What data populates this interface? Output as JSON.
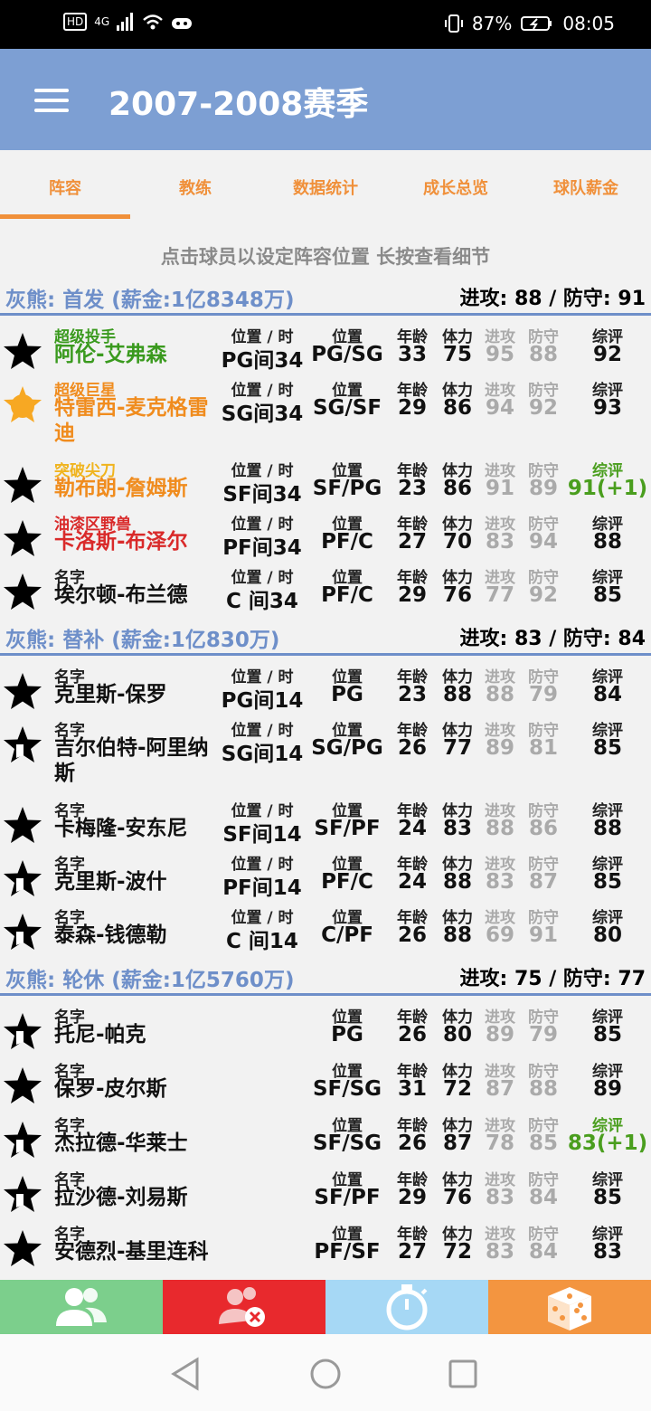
{
  "status": {
    "signal": "4G",
    "hd": "HD",
    "battery": "87%",
    "time": "08:05"
  },
  "app": {
    "title": "2007-2008赛季"
  },
  "tabs": [
    "阵容",
    "教练",
    "数据统计",
    "成长总览",
    "球队薪金"
  ],
  "hint": "点击球员以设定阵容位置 长按查看细节",
  "labels": {
    "pos_time": "位置 / 时",
    "pos": "位置",
    "age": "年龄",
    "stamina": "体力",
    "attack": "进攻",
    "defense": "防守",
    "overall": "综评"
  },
  "sections": [
    {
      "title": "灰熊: 首发 (薪金:1亿8348万)",
      "stats": "进攻: 88  /  防守: 91",
      "players": [
        {
          "tag": "超级投手",
          "tag_color": "#3a9a1e",
          "name": "阿伦-艾弗森",
          "name_color": "#3a9a1e",
          "pos_time": "PG间34",
          "pos": "PG/SG",
          "age": "33",
          "stamina": "75",
          "attack": "95",
          "defense": "88",
          "overall": "92",
          "star": "black"
        },
        {
          "tag": "超级巨星",
          "tag_color": "#f08c1e",
          "name": "特雷西-麦克格雷迪",
          "name_color": "#f08c1e",
          "pos_time": "SG间34",
          "pos": "SG/SF",
          "age": "29",
          "stamina": "86",
          "attack": "94",
          "defense": "92",
          "overall": "93",
          "star": "gold"
        },
        {
          "tag": "突破尖刀",
          "tag_color": "#f0b41e",
          "name": "勒布朗-詹姆斯",
          "name_color": "#f08c1e",
          "pos_time": "SF间34",
          "pos": "SF/PG",
          "age": "23",
          "stamina": "86",
          "attack": "91",
          "defense": "89",
          "overall": "91(+1)",
          "overall_green": true,
          "star": "black"
        },
        {
          "tag": "油漆区野兽",
          "tag_color": "#d92a2a",
          "name": "卡洛斯-布泽尔",
          "name_color": "#d92a2a",
          "pos_time": "PF间34",
          "pos": "PF/C",
          "age": "27",
          "stamina": "70",
          "attack": "83",
          "defense": "94",
          "overall": "88",
          "star": "black"
        },
        {
          "tag": "名字",
          "tag_color": "#222222",
          "name": "埃尔顿-布兰德",
          "name_color": "#111111",
          "pos_time": "C 间34",
          "pos": "PF/C",
          "age": "29",
          "stamina": "76",
          "attack": "77",
          "defense": "92",
          "overall": "85",
          "star": "black"
        }
      ]
    },
    {
      "title": "灰熊: 替补 (薪金:1亿830万)",
      "stats": "进攻: 83  /  防守: 84",
      "players": [
        {
          "tag": "名字",
          "tag_color": "#222222",
          "name": "克里斯-保罗",
          "name_color": "#111111",
          "pos_time": "PG间14",
          "pos": "PG",
          "age": "23",
          "stamina": "88",
          "attack": "88",
          "defense": "79",
          "overall": "84",
          "star": "black"
        },
        {
          "tag": "名字",
          "tag_color": "#222222",
          "name": "吉尔伯特-阿里纳斯",
          "name_color": "#111111",
          "pos_time": "SG间14",
          "pos": "SG/PG",
          "age": "26",
          "stamina": "77",
          "attack": "89",
          "defense": "81",
          "overall": "85",
          "star": "half"
        },
        {
          "tag": "名字",
          "tag_color": "#222222",
          "name": "卡梅隆-安东尼",
          "name_color": "#111111",
          "pos_time": "SF间14",
          "pos": "SF/PF",
          "age": "24",
          "stamina": "83",
          "attack": "88",
          "defense": "86",
          "overall": "88",
          "star": "black"
        },
        {
          "tag": "名字",
          "tag_color": "#222222",
          "name": "克里斯-波什",
          "name_color": "#111111",
          "pos_time": "PF间14",
          "pos": "PF/C",
          "age": "24",
          "stamina": "88",
          "attack": "83",
          "defense": "87",
          "overall": "85",
          "star": "half"
        },
        {
          "tag": "名字",
          "tag_color": "#222222",
          "name": "泰森-钱德勒",
          "name_color": "#111111",
          "pos_time": "C 间14",
          "pos": "C/PF",
          "age": "26",
          "stamina": "88",
          "attack": "69",
          "defense": "91",
          "overall": "80",
          "star": "half"
        }
      ]
    },
    {
      "title": "灰熊: 轮休 (薪金:1亿5760万)",
      "stats": "进攻: 75  /  防守: 77",
      "players": [
        {
          "tag": "名字",
          "tag_color": "#222222",
          "name": "托尼-帕克",
          "name_color": "#111111",
          "pos_time": "",
          "pos": "PG",
          "age": "26",
          "stamina": "80",
          "attack": "89",
          "defense": "79",
          "overall": "85",
          "star": "half"
        },
        {
          "tag": "名字",
          "tag_color": "#222222",
          "name": "保罗-皮尔斯",
          "name_color": "#111111",
          "pos_time": "",
          "pos": "SF/SG",
          "age": "31",
          "stamina": "72",
          "attack": "87",
          "defense": "88",
          "overall": "89",
          "star": "black"
        },
        {
          "tag": "名字",
          "tag_color": "#222222",
          "name": "杰拉德-华莱士",
          "name_color": "#111111",
          "pos_time": "",
          "pos": "SF/SG",
          "age": "26",
          "stamina": "87",
          "attack": "78",
          "defense": "85",
          "overall": "83(+1)",
          "overall_green": true,
          "star": "half"
        },
        {
          "tag": "名字",
          "tag_color": "#222222",
          "name": "拉沙德-刘易斯",
          "name_color": "#111111",
          "pos_time": "",
          "pos": "SF/PF",
          "age": "29",
          "stamina": "76",
          "attack": "83",
          "defense": "84",
          "overall": "85",
          "star": "half"
        },
        {
          "tag": "名字",
          "tag_color": "#222222",
          "name": "安德烈-基里连科",
          "name_color": "#111111",
          "pos_time": "",
          "pos": "PF/SF",
          "age": "27",
          "stamina": "72",
          "attack": "83",
          "defense": "84",
          "overall": "83",
          "star": "black"
        }
      ]
    }
  ],
  "bottom_nav": [
    {
      "icon": "roster-icon",
      "color": "#7ccf8c"
    },
    {
      "icon": "remove-player-icon",
      "color": "#e8292d"
    },
    {
      "icon": "stopwatch-icon",
      "color": "#a6d8f5"
    },
    {
      "icon": "dice-icon",
      "color": "#f39540"
    }
  ]
}
